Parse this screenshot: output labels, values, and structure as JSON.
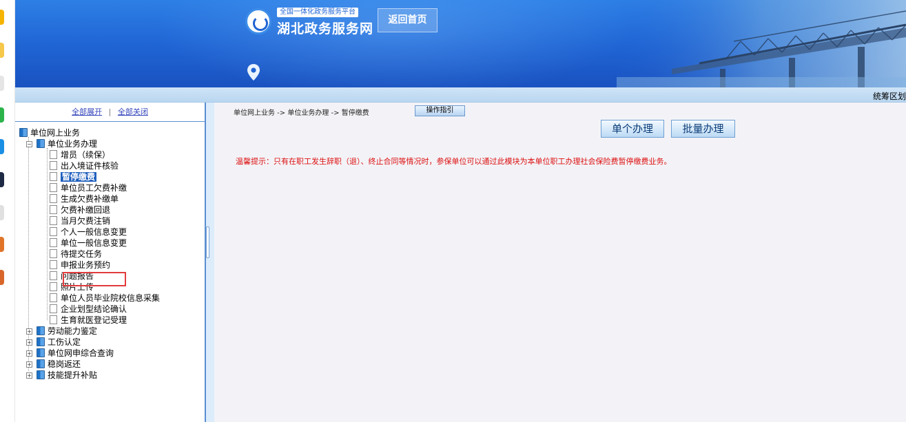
{
  "header": {
    "logo_top": "全国一体化政务服务平台",
    "logo_main": "湖北政务服务网",
    "home_button": "返回首页"
  },
  "substrip": {
    "region_text": "统筹区划"
  },
  "tree_controls": {
    "expand_all": "全部展开",
    "separator": "|",
    "collapse_all": "全部关闭"
  },
  "tree": {
    "root": "单位网上业务",
    "group": "单位业务办理",
    "items": [
      "增员（续保）",
      "出入境证件核验",
      "暂停缴费",
      "单位员工欠费补缴",
      "生成欠费补缴单",
      "欠费补缴回退",
      "当月欠费注销",
      "个人一般信息变更",
      "单位一般信息变更",
      "待提交任务",
      "申报业务预约",
      "问题报告",
      "照片上传",
      "单位人员毕业院校信息采集",
      "企业划型结论确认",
      "生育就医登记受理"
    ],
    "selected_index": 2,
    "collapsed_groups": [
      "劳动能力鉴定",
      "工伤认定",
      "单位网申综合查询",
      "稳岗返还",
      "技能提升补贴"
    ]
  },
  "main": {
    "breadcrumb": "单位网上业务 -> 单位业务办理 -> 暂停缴费",
    "guide_button": "操作指引",
    "single_button": "单个办理",
    "batch_button": "批量办理",
    "tip": "温馨提示：只有在职工发生辞职（退）、终止合同等情况时，参保单位可以通过此模块为本单位职工办理社会保险费暂停缴费业务。"
  },
  "colors": {
    "banner": "#1f63d3",
    "tip_red": "#dd1111",
    "selection": "#1f5fbd",
    "highlight_box": "#e23b3b"
  }
}
